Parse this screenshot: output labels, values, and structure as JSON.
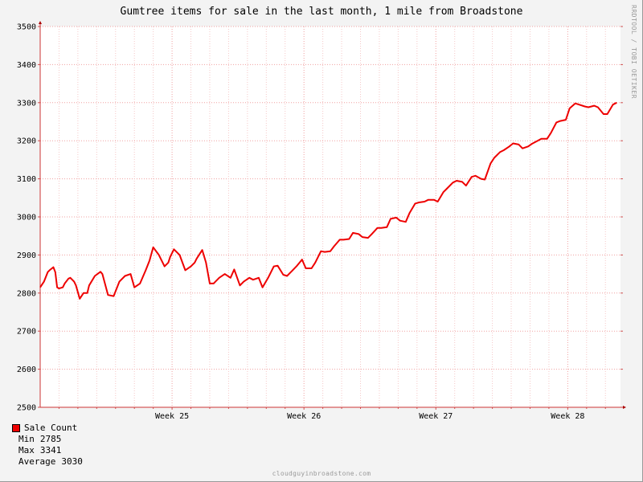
{
  "chart_data": {
    "type": "line",
    "title": "Gumtree items for sale in the last month, 1 mile from Broadstone",
    "ylim": [
      2500,
      3500
    ],
    "yticks": [
      2500,
      2600,
      2700,
      2800,
      2900,
      3000,
      3100,
      3200,
      3300,
      3400,
      3500
    ],
    "xlim": [
      0,
      30.8
    ],
    "x_label_ticks": [
      {
        "x": 7,
        "label": "Week 25"
      },
      {
        "x": 14,
        "label": "Week 26"
      },
      {
        "x": 21,
        "label": "Week 27"
      },
      {
        "x": 28,
        "label": "Week 28"
      }
    ],
    "grid": true,
    "series": [
      {
        "name": "Sale Count",
        "color": "#ee0000",
        "x": [
          0.0,
          0.2,
          0.4,
          0.5,
          0.7,
          0.8,
          0.9,
          1.0,
          1.2,
          1.3,
          1.5,
          1.6,
          1.8,
          1.9,
          2.1,
          2.3,
          2.5,
          2.6,
          2.9,
          3.2,
          3.3,
          3.6,
          3.9,
          4.2,
          4.5,
          4.8,
          5.0,
          5.3,
          5.6,
          5.8,
          6.0,
          6.3,
          6.6,
          6.8,
          6.9,
          7.1,
          7.4,
          7.7,
          8.0,
          8.2,
          8.3,
          8.6,
          8.8,
          9.0,
          9.2,
          9.5,
          9.8,
          10.1,
          10.3,
          10.6,
          10.8,
          11.1,
          11.3,
          11.6,
          11.8,
          12.1,
          12.4,
          12.6,
          12.9,
          13.1,
          13.4,
          13.6,
          13.9,
          14.1,
          14.4,
          14.6,
          14.9,
          15.1,
          15.4,
          15.6,
          15.9,
          16.1,
          16.4,
          16.6,
          16.9,
          17.1,
          17.4,
          17.6,
          17.9,
          18.1,
          18.4,
          18.6,
          18.9,
          19.1,
          19.4,
          19.6,
          19.9,
          20.1,
          20.4,
          20.6,
          20.9,
          21.1,
          21.4,
          21.6,
          21.9,
          22.1,
          22.4,
          22.6,
          22.9,
          23.1,
          23.4,
          23.6,
          23.9,
          24.1,
          24.4,
          24.6,
          24.9,
          25.1,
          25.4,
          25.6,
          25.9,
          26.1,
          26.4,
          26.6,
          26.9,
          27.1,
          27.4,
          27.6,
          27.9,
          28.1,
          28.4,
          28.6,
          28.9,
          29.1,
          29.4,
          29.6,
          29.9,
          30.1,
          30.4,
          30.6
        ],
        "values": [
          2815,
          2830,
          2855,
          2860,
          2868,
          2855,
          2815,
          2812,
          2815,
          2825,
          2838,
          2840,
          2830,
          2820,
          2785,
          2800,
          2800,
          2820,
          2845,
          2856,
          2850,
          2795,
          2792,
          2830,
          2845,
          2850,
          2815,
          2825,
          2860,
          2885,
          2920,
          2900,
          2870,
          2880,
          2895,
          2915,
          2900,
          2860,
          2870,
          2880,
          2890,
          2913,
          2880,
          2825,
          2825,
          2840,
          2850,
          2840,
          2862,
          2820,
          2830,
          2840,
          2835,
          2840,
          2815,
          2840,
          2870,
          2872,
          2848,
          2845,
          2860,
          2870,
          2888,
          2865,
          2865,
          2880,
          2910,
          2908,
          2910,
          2923,
          2940,
          2940,
          2942,
          2958,
          2955,
          2947,
          2945,
          2955,
          2971,
          2971,
          2973,
          2995,
          2998,
          2990,
          2987,
          3010,
          3035,
          3038,
          3040,
          3045,
          3045,
          3040,
          3065,
          3075,
          3090,
          3095,
          3092,
          3082,
          3105,
          3108,
          3100,
          3098,
          3140,
          3155,
          3170,
          3175,
          3185,
          3193,
          3190,
          3180,
          3185,
          3192,
          3200,
          3205,
          3205,
          3220,
          3248,
          3252,
          3255,
          3285,
          3298,
          3295,
          3290,
          3288,
          3292,
          3288,
          3270,
          3270,
          3295,
          3300
        ]
      }
    ],
    "legend": {
      "name": "Sale Count",
      "color": "#ee0000",
      "min_label": "Min",
      "min_value": "2785",
      "max_label": "Max",
      "max_value": "3341",
      "avg_label": "Average",
      "avg_value": "3030"
    }
  },
  "watermark": "cloudguyinbroadstone.com",
  "side_label": "RRDTOOL / TOBI OETIKER"
}
